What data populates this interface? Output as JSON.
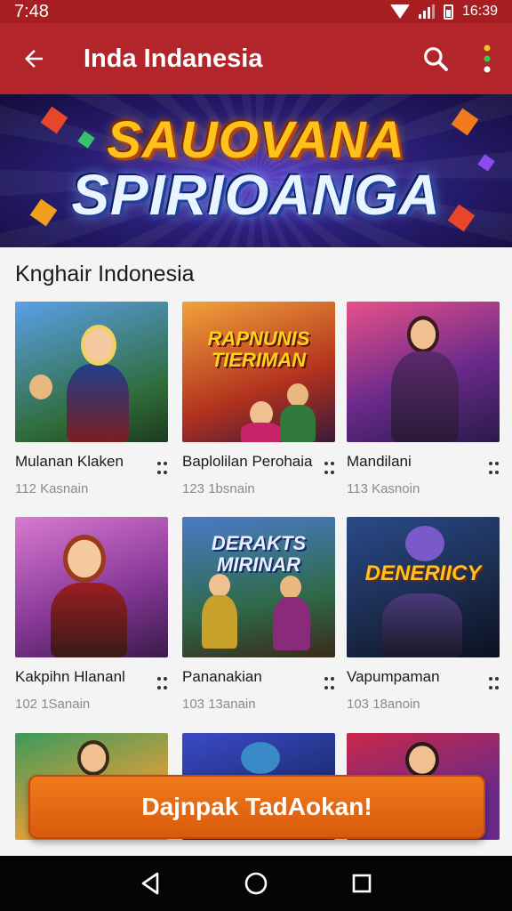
{
  "status": {
    "time": "7:48",
    "battery_text": "16:39"
  },
  "app_bar": {
    "title": "Inda Indanesia"
  },
  "banner": {
    "line1": "SAUOVANA",
    "line2": "SPIRIOANGA"
  },
  "section": {
    "title": "Knghair Indonesia"
  },
  "cards": [
    {
      "title": "Mulanan Klaken",
      "meta": "112  Kasnain",
      "thumb_text": ""
    },
    {
      "title": "Baplolilan Perohaia",
      "meta": "123  1bsnain",
      "thumb_text": "RAPNUNIS TIERIMAN"
    },
    {
      "title": "Mandilani",
      "meta": "113  Kasnoin",
      "thumb_text": ""
    },
    {
      "title": "Kakpihn Hlananl",
      "meta": "102  1Sanain",
      "thumb_text": ""
    },
    {
      "title": "Pananakian",
      "meta": "103  13anain",
      "thumb_text": "DERAKTS MIRINAR"
    },
    {
      "title": "Vapumpaman",
      "meta": "103  18anoin",
      "thumb_text": "DENERIICY"
    },
    {
      "title": "",
      "meta": "",
      "thumb_text": ""
    },
    {
      "title": "",
      "meta": "",
      "thumb_text": ""
    },
    {
      "title": "",
      "meta": "",
      "thumb_text": ""
    }
  ],
  "cta": {
    "label": "Dajnpak TadAokan!"
  },
  "icons": {
    "back": "arrow-left-icon",
    "search": "search-icon",
    "more": "more-vert-icon",
    "nav_back": "triangle-back-icon",
    "nav_home": "circle-home-icon",
    "nav_recent": "square-recent-icon"
  },
  "colors": {
    "app_bar": "#b2252a",
    "status_bar": "#a81e22",
    "cta": "#e8701a",
    "background": "#f4f4f4"
  }
}
